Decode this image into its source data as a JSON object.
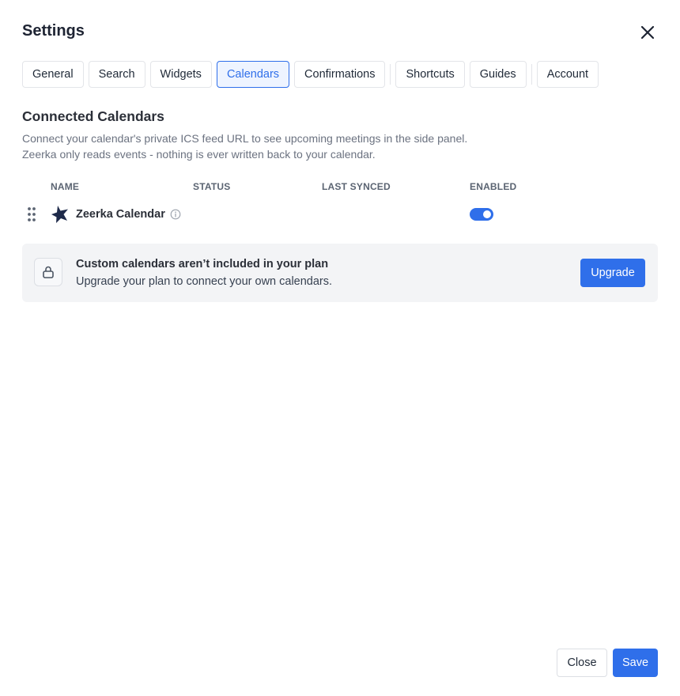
{
  "header": {
    "title": "Settings"
  },
  "tabs": [
    {
      "label": "General",
      "active": false
    },
    {
      "label": "Search",
      "active": false
    },
    {
      "label": "Widgets",
      "active": false
    },
    {
      "label": "Calendars",
      "active": true
    },
    {
      "label": "Confirmations",
      "active": false
    },
    {
      "label": "Shortcuts",
      "active": false
    },
    {
      "label": "Guides",
      "active": false
    },
    {
      "label": "Account",
      "active": false
    }
  ],
  "section": {
    "title": "Connected Calendars",
    "description_line1": "Connect your calendar's private ICS feed URL to see upcoming meetings in the side panel.",
    "description_line2": "Zeerka only reads events - nothing is ever written back to your calendar."
  },
  "table": {
    "columns": {
      "name": "NAME",
      "status": "STATUS",
      "last_synced": "LAST SYNCED",
      "enabled": "ENABLED"
    },
    "rows": [
      {
        "name": "Zeerka Calendar",
        "status": "",
        "last_synced": "",
        "enabled": true,
        "icon": "zeerka-logo-icon"
      }
    ]
  },
  "banner": {
    "title": "Custom calendars aren’t included in your plan",
    "text": "Upgrade your plan to connect your own calendars.",
    "button_label": "Upgrade",
    "icon": "lock-icon"
  },
  "footer": {
    "close_label": "Close",
    "save_label": "Save"
  },
  "colors": {
    "accent": "#2f6fea",
    "brand_dark": "#1e2a4a",
    "banner_bg": "#f3f4f6"
  }
}
